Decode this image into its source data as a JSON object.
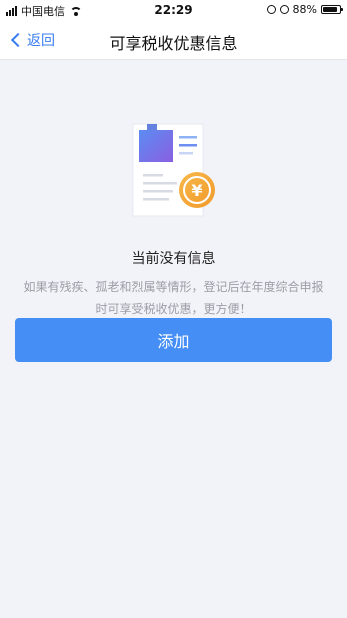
{
  "status_bar": {
    "carrier": "中国电信",
    "time": "22:29",
    "battery_percent": "88%",
    "battery_level": 0.88
  },
  "nav": {
    "back_label": "返回",
    "title": "可享税收优惠信息"
  },
  "empty_state": {
    "illustration_icon": "document-yuan-icon",
    "currency_symbol": "¥",
    "title": "当前没有信息",
    "description": "如果有残疾、孤老和烈属等情形，登记后在年度综合申报时可享受税收优惠，更方便！"
  },
  "actions": {
    "add_label": "添加"
  },
  "colors": {
    "accent": "#448ef5",
    "link": "#3a7ef0",
    "background": "#f2f3f8",
    "coin": "#f5a623"
  }
}
